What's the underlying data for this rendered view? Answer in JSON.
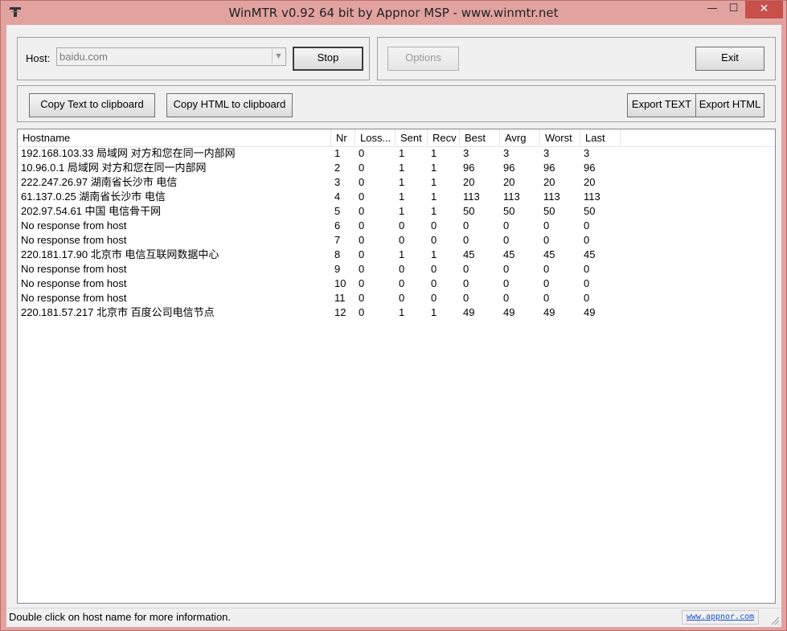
{
  "window": {
    "title": "WinMTR v0.92 64 bit by Appnor MSP - www.winmtr.net",
    "minimize_glyph": "—",
    "maximize_glyph": "☐",
    "close_glyph": "✕"
  },
  "host_group": {
    "host_label": "Host:",
    "host_value": "baidu.com",
    "stop_label": "Stop"
  },
  "options_group": {
    "options_label": "Options",
    "exit_label": "Exit"
  },
  "export_group": {
    "copy_text_label": "Copy Text to clipboard",
    "copy_html_label": "Copy HTML to clipboard",
    "export_text_label": "Export TEXT",
    "export_html_label": "Export HTML"
  },
  "table": {
    "columns": [
      "Hostname",
      "Nr",
      "Loss...",
      "Sent",
      "Recv",
      "Best",
      "Avrg",
      "Worst",
      "Last"
    ],
    "rows": [
      [
        "192.168.103.33 局域网 对方和您在同一内部网",
        "1",
        "0",
        "1",
        "1",
        "3",
        "3",
        "3",
        "3"
      ],
      [
        "10.96.0.1 局域网 对方和您在同一内部网",
        "2",
        "0",
        "1",
        "1",
        "96",
        "96",
        "96",
        "96"
      ],
      [
        "222.247.26.97 湖南省长沙市 电信",
        "3",
        "0",
        "1",
        "1",
        "20",
        "20",
        "20",
        "20"
      ],
      [
        "61.137.0.25 湖南省长沙市 电信",
        "4",
        "0",
        "1",
        "1",
        "113",
        "113",
        "113",
        "113"
      ],
      [
        "202.97.54.61 中国 电信骨干网",
        "5",
        "0",
        "1",
        "1",
        "50",
        "50",
        "50",
        "50"
      ],
      [
        "No response from host",
        "6",
        "0",
        "0",
        "0",
        "0",
        "0",
        "0",
        "0"
      ],
      [
        "No response from host",
        "7",
        "0",
        "0",
        "0",
        "0",
        "0",
        "0",
        "0"
      ],
      [
        "220.181.17.90 北京市 电信互联网数据中心",
        "8",
        "0",
        "1",
        "1",
        "45",
        "45",
        "45",
        "45"
      ],
      [
        "No response from host",
        "9",
        "0",
        "0",
        "0",
        "0",
        "0",
        "0",
        "0"
      ],
      [
        "No response from host",
        "10",
        "0",
        "0",
        "0",
        "0",
        "0",
        "0",
        "0"
      ],
      [
        "No response from host",
        "11",
        "0",
        "0",
        "0",
        "0",
        "0",
        "0",
        "0"
      ],
      [
        "220.181.57.217 北京市 百度公司电信节点",
        "12",
        "0",
        "1",
        "1",
        "49",
        "49",
        "49",
        "49"
      ]
    ]
  },
  "statusbar": {
    "text": "Double click on host name for more information.",
    "link": "www.appnor.com"
  }
}
